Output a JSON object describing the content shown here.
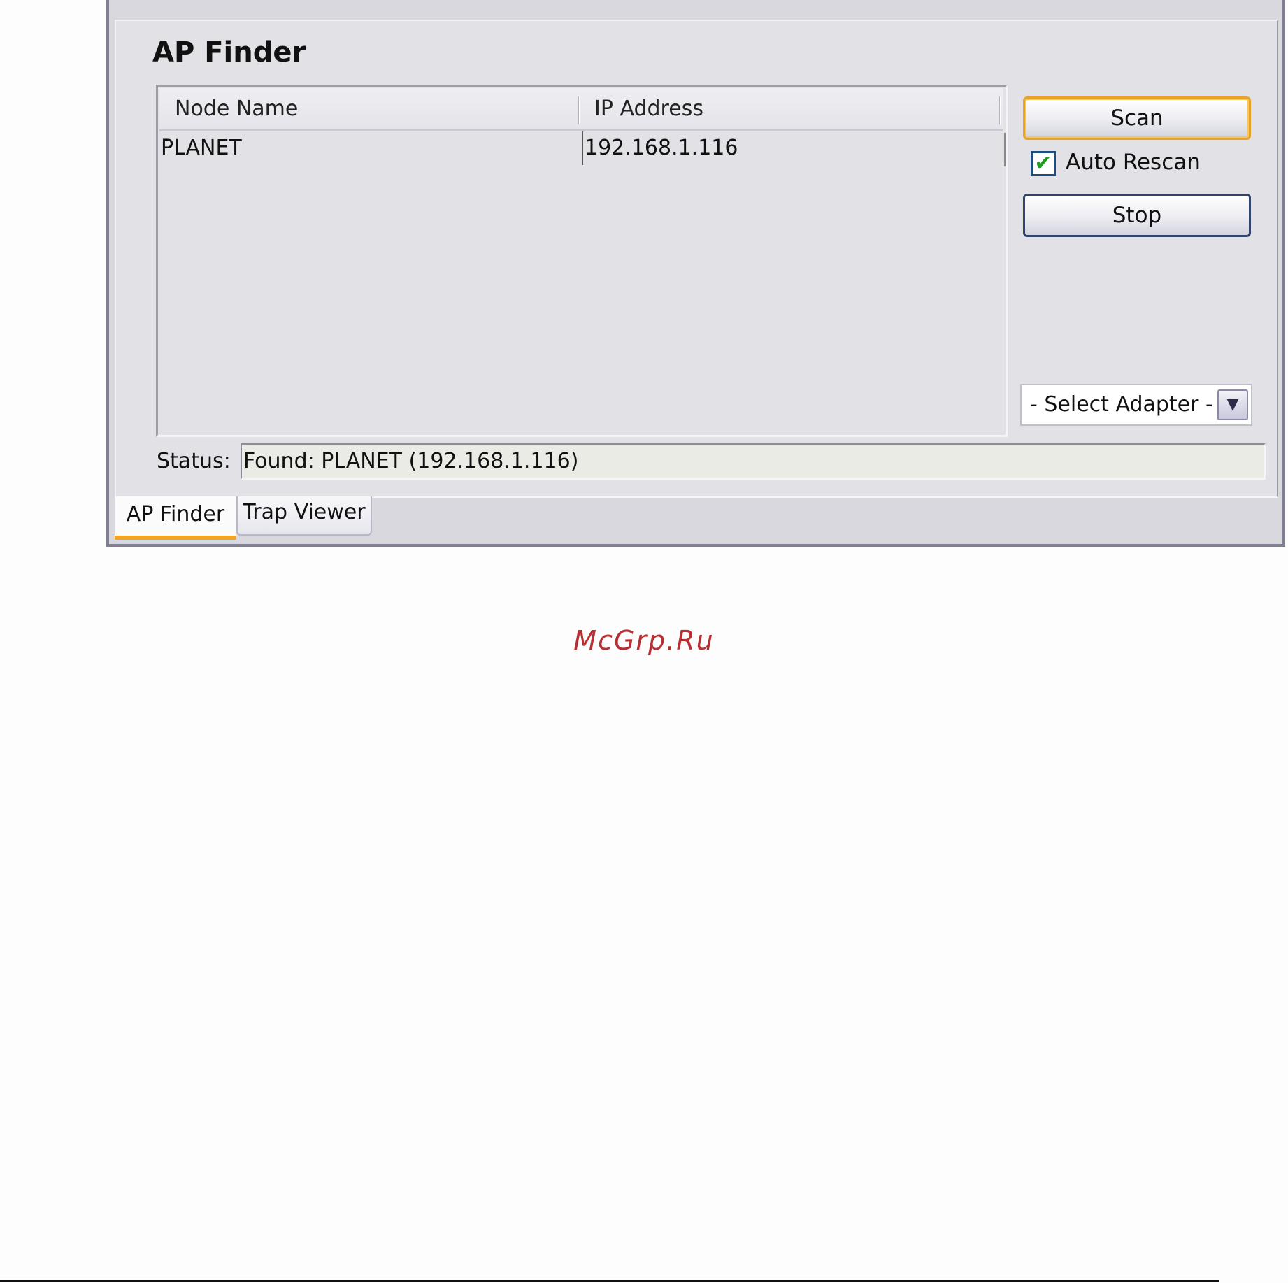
{
  "panel": {
    "title": "AP Finder"
  },
  "table": {
    "columns": [
      "Node Name",
      "IP Address"
    ],
    "rows": [
      [
        "PLANET",
        "192.168.1.116"
      ]
    ]
  },
  "controls": {
    "scan_label": "Scan",
    "auto_rescan_label": "Auto Rescan",
    "auto_rescan_checked": true,
    "stop_label": "Stop",
    "adapter_select_value": "- Select Adapter -"
  },
  "status": {
    "label": "Status:",
    "value": "Found: PLANET (192.168.1.116)"
  },
  "tabs": [
    {
      "label": "AP Finder",
      "active": true
    },
    {
      "label": "Trap Viewer",
      "active": false
    }
  ],
  "watermark": "McGrp.Ru",
  "colors": {
    "accent_orange": "#f2a524",
    "check_green": "#1e9e1e",
    "watermark_red": "#b72f32"
  },
  "icons": {
    "checkbox": "checkmark-icon",
    "dropdown": "chevron-down-icon"
  }
}
